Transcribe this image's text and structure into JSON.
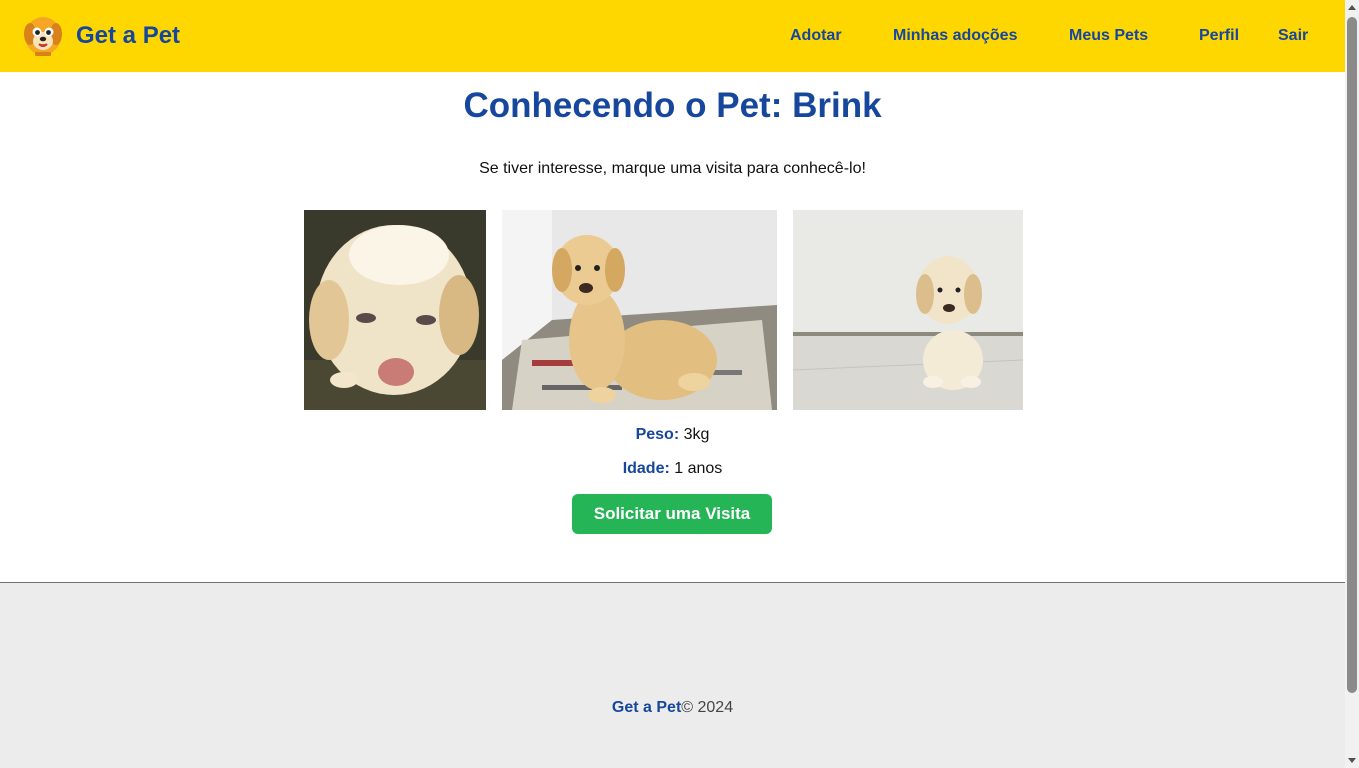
{
  "navbar": {
    "brand": "Get a Pet",
    "links": [
      "Adotar",
      "Minhas adoções",
      "Meus Pets",
      "Perfil",
      "Sair"
    ],
    "bg_color": "#FFD700",
    "link_color": "#16479d"
  },
  "pet": {
    "title": "Conhecendo o Pet: Brink",
    "subtitle": "Se tiver interesse, marque uma visita para conhecê-lo!",
    "weight_label": "Peso:",
    "weight_value": "3kg",
    "age_label": "Idade:",
    "age_value": "1 anos",
    "photos": [
      "puppy-photo-1",
      "puppy-photo-2",
      "puppy-photo-3"
    ]
  },
  "actions": {
    "request_visit": "Solicitar uma Visita",
    "button_color": "#25b456"
  },
  "footer": {
    "brand": "Get a Pet",
    "copyright": "© 2024"
  }
}
